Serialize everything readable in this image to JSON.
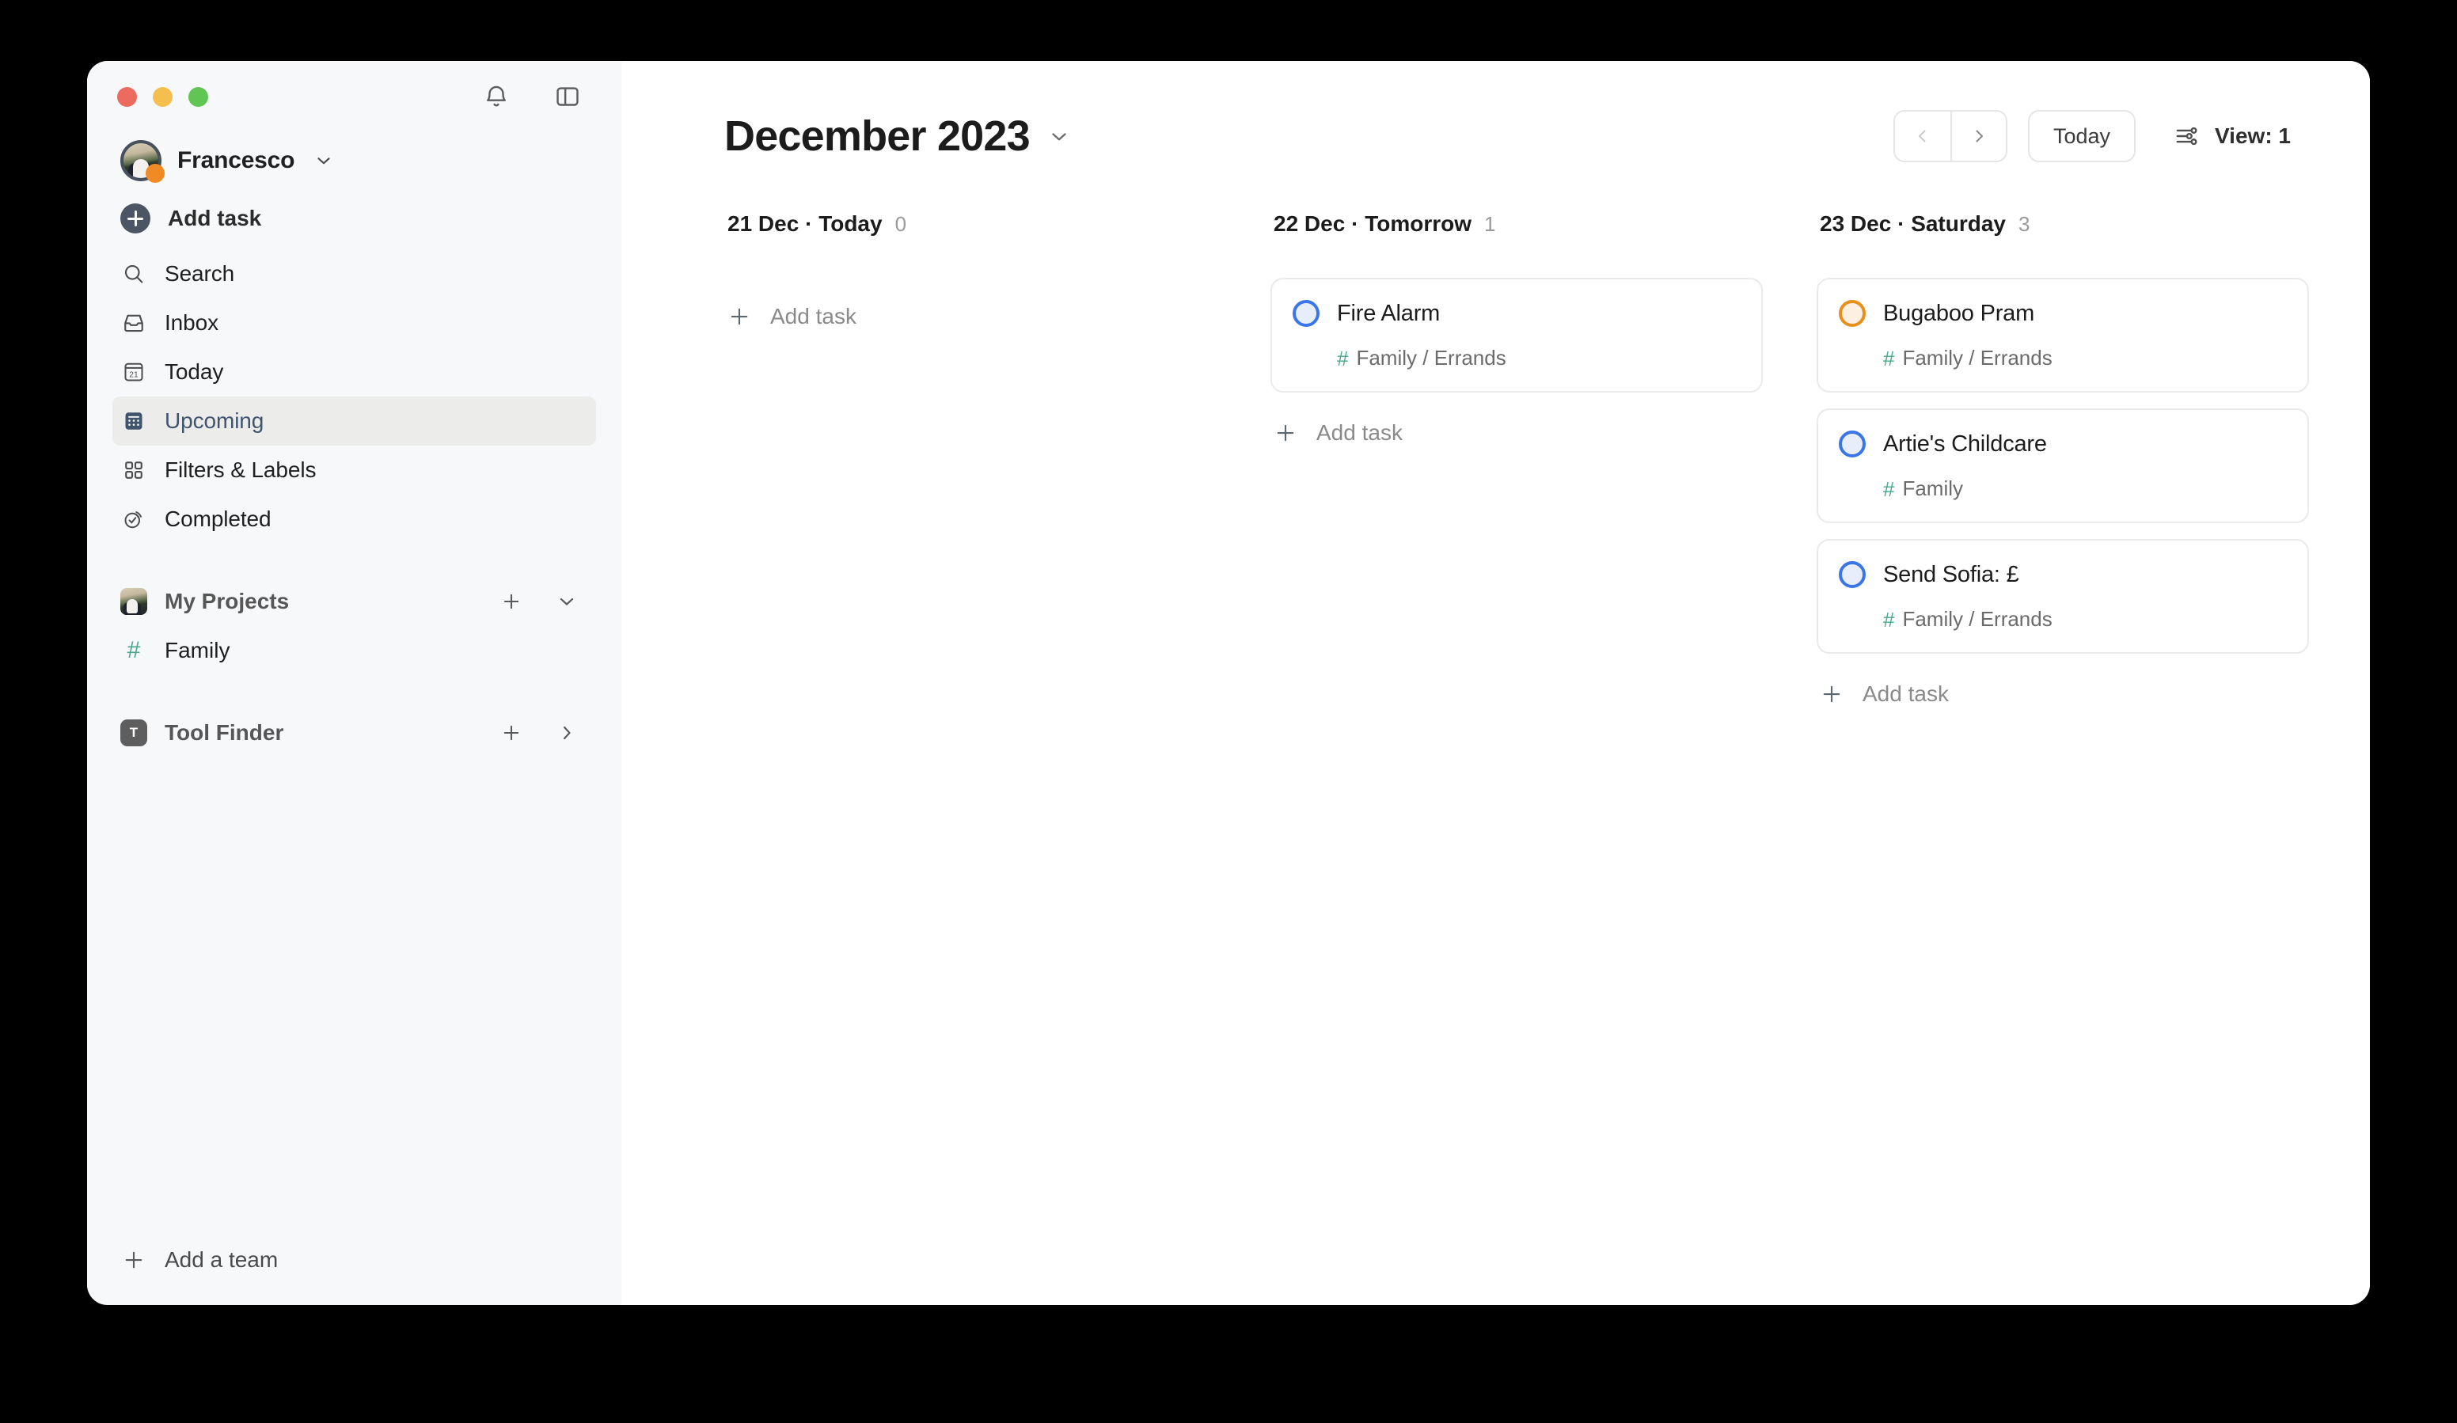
{
  "window": {
    "traffic_lights": [
      "close",
      "minimize",
      "zoom"
    ]
  },
  "sidebar": {
    "top_icons": [
      {
        "name": "notifications-icon",
        "label": "Notifications"
      },
      {
        "name": "sidebar-toggle-icon",
        "label": "Toggle sidebar"
      }
    ],
    "user": {
      "name": "Francesco"
    },
    "add_task": {
      "label": "Add task"
    },
    "nav_items": [
      {
        "label": "Search",
        "icon": "search-icon",
        "active": false
      },
      {
        "label": "Inbox",
        "icon": "inbox-icon",
        "active": false
      },
      {
        "label": "Today",
        "icon": "calendar-21-icon",
        "day": "21",
        "active": false
      },
      {
        "label": "Upcoming",
        "icon": "upcoming-icon",
        "active": true
      },
      {
        "label": "Filters & Labels",
        "icon": "grid-icon",
        "active": false
      },
      {
        "label": "Completed",
        "icon": "check-circle-icon",
        "active": false
      }
    ],
    "my_projects": {
      "title": "My Projects",
      "add_label": "Add project",
      "collapse_label": "Collapse",
      "projects": [
        {
          "label": "Family",
          "hash": "#"
        }
      ]
    },
    "tool_finder": {
      "title": "Tool Finder",
      "initial": "T",
      "add_label": "Add project",
      "expand_label": "Expand"
    },
    "footer": {
      "label": "Add a team"
    }
  },
  "header": {
    "title": "December 2023",
    "prev_label": "Previous",
    "next_label": "Next",
    "today_label": "Today",
    "view_label": "View: 1"
  },
  "board": {
    "add_task_label": "Add task",
    "columns": [
      {
        "date": "21 Dec",
        "separator": "·",
        "dayname": "Today",
        "count": "0",
        "tasks": []
      },
      {
        "date": "22 Dec",
        "separator": "·",
        "dayname": "Tomorrow",
        "count": "1",
        "tasks": [
          {
            "title": "Fire Alarm",
            "project_hash": "#",
            "project_path": "Family / Errands",
            "priority": "p4",
            "checkbox_color": "#3b76e8"
          }
        ]
      },
      {
        "date": "23 Dec",
        "separator": "·",
        "dayname": "Saturday",
        "count": "3",
        "tasks": [
          {
            "title": "Bugaboo Pram",
            "project_hash": "#",
            "project_path": "Family / Errands",
            "priority": "p3",
            "checkbox_color": "#e8901d"
          },
          {
            "title": "Artie's Childcare",
            "project_hash": "#",
            "project_path": "Family",
            "priority": "p4",
            "checkbox_color": "#3b76e8"
          },
          {
            "title": "Send Sofia: £",
            "project_hash": "#",
            "project_path": "Family / Errands",
            "priority": "p4",
            "checkbox_color": "#3b76e8"
          }
        ]
      }
    ]
  },
  "colors": {
    "accent_blue": "#3b76e8",
    "accent_orange": "#e8901d",
    "project_green": "#4aa88a",
    "sidebar_bg": "#f7f8fa",
    "active_bg": "#ececeb"
  }
}
